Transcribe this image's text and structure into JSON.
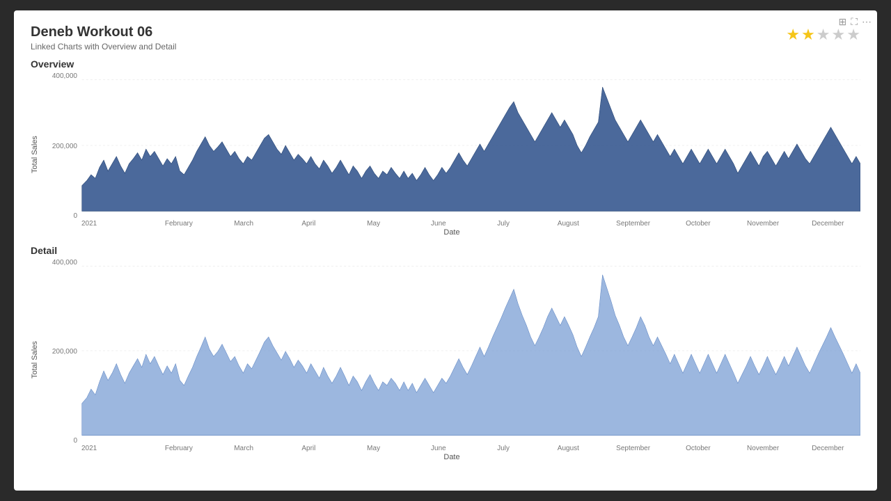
{
  "title": "Deneb Workout 06",
  "subtitle": "Linked Charts with Overview and Detail",
  "stars": [
    true,
    true,
    false,
    false,
    false
  ],
  "toolbar": {
    "icons": [
      "⊞",
      "⛶",
      "⋯"
    ]
  },
  "overview": {
    "label": "Overview",
    "y_axis_title": "Total Sales",
    "x_axis_title": "Date",
    "y_labels": [
      "400,000",
      "200,000",
      "0"
    ],
    "x_labels": [
      "2021",
      "February",
      "March",
      "April",
      "May",
      "June",
      "July",
      "August",
      "September",
      "October",
      "November",
      "December"
    ]
  },
  "detail": {
    "label": "Detail",
    "y_axis_title": "Total Sales",
    "x_axis_title": "Date",
    "y_labels": [
      "400,000",
      "200,000",
      "0"
    ],
    "x_labels": [
      "2021",
      "February",
      "March",
      "April",
      "May",
      "June",
      "July",
      "August",
      "September",
      "October",
      "November",
      "December"
    ]
  }
}
